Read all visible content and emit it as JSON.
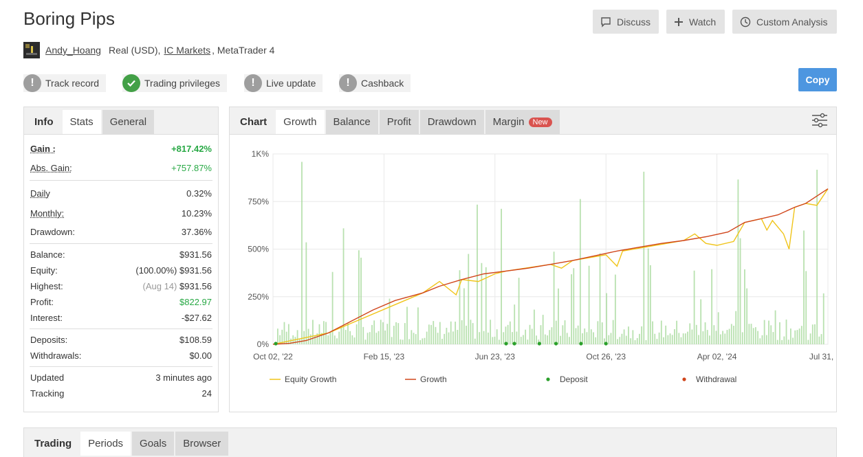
{
  "header": {
    "title": "Boring Pips",
    "buttons": {
      "discuss": "Discuss",
      "watch": "Watch",
      "custom_analysis": "Custom Analysis"
    },
    "user": "Andy_Hoang",
    "account_type": "Real (USD),",
    "broker": "IC Markets",
    "platform": ", MetaTrader 4"
  },
  "badges": {
    "track_record": "Track record",
    "trading_privileges": "Trading privileges",
    "live_update": "Live update",
    "cashback": "Cashback",
    "copy": "Copy"
  },
  "left_tabs": {
    "info": "Info",
    "stats": "Stats",
    "general": "General"
  },
  "stats": {
    "gain_label": "Gain :",
    "gain": "+817.42%",
    "abs_gain_label": "Abs. Gain:",
    "abs_gain": "+757.87%",
    "daily_label": "Daily",
    "daily": "0.32%",
    "monthly_label": "Monthly:",
    "monthly": "10.23%",
    "drawdown_label": "Drawdown:",
    "drawdown": "37.36%",
    "balance_label": "Balance:",
    "balance": "$931.56",
    "equity_label": "Equity:",
    "equity_pct": "(100.00%)",
    "equity": "$931.56",
    "highest_label": "Highest:",
    "highest_date": "(Aug 14)",
    "highest": "$931.56",
    "profit_label": "Profit:",
    "profit": "$822.97",
    "interest_label": "Interest:",
    "interest": "-$27.62",
    "deposits_label": "Deposits:",
    "deposits": "$108.59",
    "withdrawals_label": "Withdrawals:",
    "withdrawals": "$0.00",
    "updated_label": "Updated",
    "updated": "3 minutes ago",
    "tracking_label": "Tracking",
    "tracking": "24"
  },
  "chart_tabs": {
    "chart": "Chart",
    "growth": "Growth",
    "balance": "Balance",
    "profit": "Profit",
    "drawdown": "Drawdown",
    "margin": "Margin",
    "new_badge": "New"
  },
  "bottom_tabs": {
    "trading": "Trading",
    "periods": "Periods",
    "goals": "Goals",
    "browser": "Browser"
  },
  "colors": {
    "growth": "#d0451b",
    "equity": "#f0c419",
    "deposit": "#2ba02b",
    "withdrawal": "#d0451b",
    "bars": "#a6d99b",
    "accent": "#4d96e0"
  },
  "chart_data": {
    "type": "line",
    "y_ticks": [
      "0%",
      "250%",
      "500%",
      "750%",
      "1K%"
    ],
    "ylim": [
      0,
      1000
    ],
    "x_ticks": [
      "Oct 02, '22",
      "Feb 15, '23",
      "Jun 23, '23",
      "Oct 26, '23",
      "Apr 02, '24",
      "Jul 31, '24"
    ],
    "legend": [
      "Equity Growth",
      "Growth",
      "Deposit",
      "Withdrawal"
    ],
    "grid": true,
    "series": [
      {
        "name": "Growth",
        "points": [
          [
            0,
            0
          ],
          [
            0.03,
            5
          ],
          [
            0.06,
            20
          ],
          [
            0.1,
            60
          ],
          [
            0.14,
            120
          ],
          [
            0.18,
            180
          ],
          [
            0.22,
            230
          ],
          [
            0.27,
            270
          ],
          [
            0.3,
            305
          ],
          [
            0.34,
            340
          ],
          [
            0.38,
            370
          ],
          [
            0.42,
            385
          ],
          [
            0.46,
            400
          ],
          [
            0.5,
            420
          ],
          [
            0.54,
            440
          ],
          [
            0.58,
            465
          ],
          [
            0.62,
            490
          ],
          [
            0.66,
            510
          ],
          [
            0.7,
            530
          ],
          [
            0.74,
            545
          ],
          [
            0.78,
            565
          ],
          [
            0.82,
            590
          ],
          [
            0.85,
            640
          ],
          [
            0.88,
            660
          ],
          [
            0.91,
            680
          ],
          [
            0.94,
            720
          ],
          [
            0.96,
            740
          ],
          [
            1.0,
            817
          ]
        ]
      },
      {
        "name": "Equity Growth",
        "points": [
          [
            0,
            0
          ],
          [
            0.1,
            60
          ],
          [
            0.27,
            270
          ],
          [
            0.3,
            330
          ],
          [
            0.33,
            260
          ],
          [
            0.34,
            340
          ],
          [
            0.37,
            330
          ],
          [
            0.4,
            370
          ],
          [
            0.42,
            385
          ],
          [
            0.5,
            420
          ],
          [
            0.52,
            400
          ],
          [
            0.54,
            440
          ],
          [
            0.6,
            470
          ],
          [
            0.62,
            410
          ],
          [
            0.63,
            490
          ],
          [
            0.74,
            545
          ],
          [
            0.76,
            580
          ],
          [
            0.78,
            530
          ],
          [
            0.8,
            520
          ],
          [
            0.83,
            540
          ],
          [
            0.85,
            640
          ],
          [
            0.88,
            660
          ],
          [
            0.89,
            600
          ],
          [
            0.9,
            650
          ],
          [
            0.92,
            580
          ],
          [
            0.93,
            500
          ],
          [
            0.94,
            720
          ],
          [
            0.96,
            740
          ],
          [
            0.98,
            730
          ],
          [
            1.0,
            817
          ]
        ]
      }
    ],
    "deposits_x": [
      0.005,
      0.42,
      0.435,
      0.48,
      0.51,
      0.555,
      0.6
    ]
  }
}
